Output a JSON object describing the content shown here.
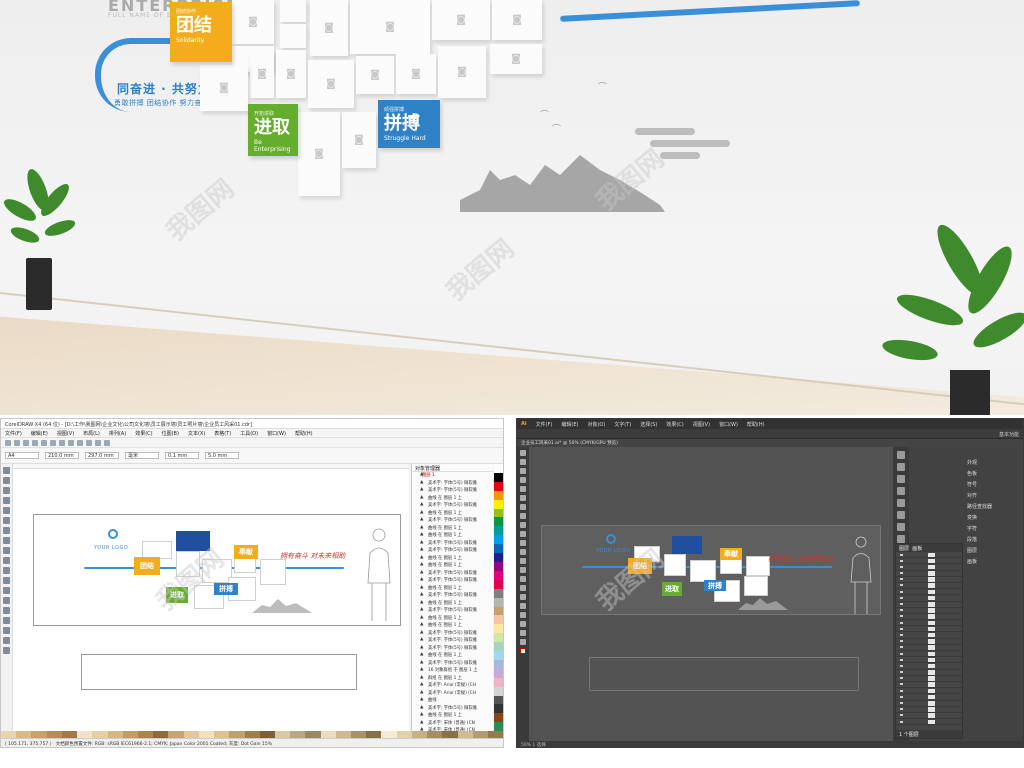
{
  "watermark": "我图网",
  "scene": {
    "header": {
      "title": "ENTERPRISE",
      "subtitle": "FULL NAME OF ENTERPRISE"
    },
    "slogan": "同奋进 · 共努力",
    "slogan_sub": "勇敢拼搏  团结协作  努力奋斗  活力无限",
    "tags": {
      "yellow": {
        "small": "团结协作",
        "big": "团结",
        "en": "Solidarity"
      },
      "green": {
        "small": "开拓进取",
        "big": "进取",
        "en": "Be Enterprising"
      },
      "blue": {
        "small": "顽强拼搏",
        "big": "拼搏",
        "en": "Struggle Hard"
      }
    },
    "colors": {
      "yellow": "#f2ac1c",
      "green": "#65ad2c",
      "blue": "#2f82c6",
      "track": "#3b8fd6"
    }
  },
  "coreldraw": {
    "title": "CorelDRAW X4 (64 位) - [D:\\工作\\我图网\\企业文化\\公司文化墙\\员工展示墙\\员工照片墙\\企业员工风采01.cdr]",
    "menu": [
      "文件(F)",
      "编辑(E)",
      "视图(V)",
      "布局(L)",
      "排列(A)",
      "效果(C)",
      "位图(B)",
      "文本(X)",
      "表格(T)",
      "工具(O)",
      "窗口(W)",
      "帮助(H)"
    ],
    "prop_fields": [
      "A4",
      "210.0 mm",
      "297.0 mm",
      "毫米",
      "0.1 mm",
      "5.0 mm"
    ],
    "docker_title": "对象管理器",
    "layer_label": "图层 1",
    "docker_rows": [
      "美术字: 字体(5号) 微软雅",
      "美术字: 字体(5号) 微软雅",
      "曲线 在 图层 1 上",
      "美术字: 字体(5号) 微软雅",
      "曲线 在 图层 1 上",
      "美术字: 字体(5号) 微软雅",
      "曲线 在 图层 1 上",
      "曲线 在 图层 1 上",
      "美术字: 字体(5号) 微软雅",
      "美术字: 字体(5号) 微软雅",
      "曲线 在 图层 1 上",
      "曲线 在 图层 1 上",
      "美术字: 字体(5号) 微软雅",
      "美术字: 字体(5号) 微软雅",
      "曲线 在 图层 1 上",
      "美术字: 字体(5号) 微软雅",
      "曲线 在 图层 1 上",
      "美术字: 字体(5号) 微软雅",
      "曲线 在 图层 1 上",
      "曲线 在 图层 1 上",
      "美术字: 字体(5号) 微软雅",
      "美术字: 字体(5号) 微软雅",
      "美术字: 字体(5号) 微软雅",
      "曲线 在 图层 1 上",
      "美术字: 字体(5号) 微软雅",
      "16 对象群组 于 图层 1 上",
      "群组 在 图层 1 上",
      "美术字: Arial (常规) (CH",
      "美术字: Arial (常规) (CH",
      "曲线",
      "美术字: 字体(5号) 微软雅",
      "曲线 在 图层 1 上",
      "美术字: 宋体 (普通) (CN",
      "美术字: 宋体 (普通) (CN",
      "矩形 在 图层 1 上"
    ],
    "page_nav": "1 / 1",
    "status": "文档颜色预置文件: RGB: sRGB IEC61966-2.1; CMYK: Japan Color 2001 Coated; 灰度: Dot Gain 15%",
    "coords": "( 105.171, 375.757 )"
  },
  "artwork": {
    "logo": "YOUR LOGO",
    "tag_yellow": "团结",
    "tag_green": "进取",
    "tag_blue": "拼搏",
    "tag_gold": "奉献",
    "slogan_red": "拥有奋斗  对未来相助"
  },
  "illustrator": {
    "menu": [
      "文件(F)",
      "编辑(E)",
      "对象(O)",
      "文字(T)",
      "选择(S)",
      "效果(C)",
      "视图(V)",
      "窗口(W)",
      "帮助(H)"
    ],
    "workspace": "基本功能",
    "tab": "企业员工风采01.ai* @ 50% (CMYK/GPU 预览)",
    "panel_names": [
      "外观",
      "色板",
      "符号",
      "对齐",
      "路径查找器",
      "变换",
      "字符",
      "段落",
      "图层",
      "画板"
    ],
    "layers_title": "图层",
    "layers_title_2": "画板",
    "layer_count": "1 个图层",
    "status": "50%   1   选择"
  }
}
